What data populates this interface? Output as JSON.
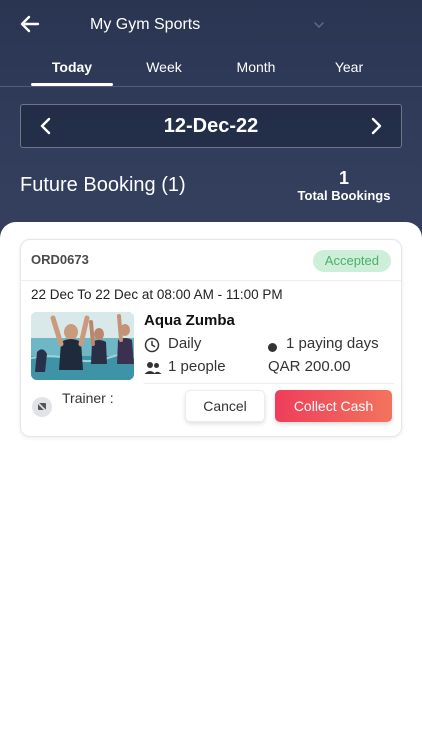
{
  "header": {
    "gym_name": "My Gym Sports",
    "tabs": [
      {
        "label": "Today",
        "active": true
      },
      {
        "label": "Week",
        "active": false
      },
      {
        "label": "Month",
        "active": false
      },
      {
        "label": "Year",
        "active": false
      }
    ],
    "date": "12-Dec-22"
  },
  "summary": {
    "title": "Future Booking (1)",
    "total_count": "1",
    "total_label": "Total Bookings"
  },
  "booking": {
    "order_id": "ORD0673",
    "status": "Accepted",
    "schedule": "22 Dec To 22 Dec at 08:00 AM - 11:00 PM",
    "class_name": "Aqua Zumba",
    "frequency": "Daily",
    "paying_days": "1 paying days",
    "people": "1 people",
    "price": "QAR 200.00",
    "trainer_label": "Trainer :",
    "cancel_label": "Cancel",
    "collect_label": "Collect Cash"
  },
  "colors": {
    "header_bg": "#2f3a58",
    "accent_gradient_start": "#ef3d5b",
    "accent_gradient_end": "#f2745d",
    "status_bg": "#cdeed8",
    "status_text": "#4caf6a"
  },
  "icons": {
    "back": "arrow-left-icon",
    "gym_dropdown": "chevron-down-icon",
    "date_prev": "chevron-left-icon",
    "date_next": "chevron-right-icon",
    "frequency": "clock-icon",
    "paying": "dot-icon",
    "people": "people-icon",
    "trainer": "avatar-icon"
  }
}
